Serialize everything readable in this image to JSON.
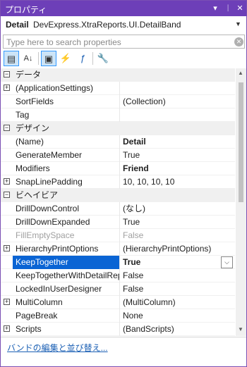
{
  "window": {
    "title": "プロパティ",
    "dropdown_glyph": "▾",
    "pin_glyph": "ᛁ",
    "close_glyph": "✕"
  },
  "object_selector": {
    "name": "Detail",
    "type": "DevExpress.XtraReports.UI.DetailBand",
    "arrow": "▼"
  },
  "search": {
    "placeholder": "Type here to search properties",
    "clear_glyph": "✕"
  },
  "toolbar": {
    "categorized_icon": "▤",
    "alphabetical_icon": "A↓",
    "properties_icon": "▣",
    "events_icon": "⚡",
    "expressions_icon": "ƒ",
    "settings_icon": "🔧"
  },
  "grid": {
    "expand_glyph": "+",
    "collapse_glyph": "−",
    "categories": {
      "data": "データ",
      "design": "デザイン",
      "behavior": "ビヘイビア"
    },
    "rows": {
      "application_settings": {
        "name": "(ApplicationSettings)",
        "value": ""
      },
      "sort_fields": {
        "name": "SortFields",
        "value": "(Collection)"
      },
      "tag": {
        "name": "Tag",
        "value": ""
      },
      "name": {
        "name": "(Name)",
        "value": "Detail"
      },
      "generate_member": {
        "name": "GenerateMember",
        "value": "True"
      },
      "modifiers": {
        "name": "Modifiers",
        "value": "Friend"
      },
      "snap_line_padding": {
        "name": "SnapLinePadding",
        "value": "10, 10, 10, 10"
      },
      "drill_down_control": {
        "name": "DrillDownControl",
        "value": "(なし)"
      },
      "drill_down_expanded": {
        "name": "DrillDownExpanded",
        "value": "True"
      },
      "fill_empty_space": {
        "name": "FillEmptySpace",
        "value": "False"
      },
      "hierarchy_print_options": {
        "name": "HierarchyPrintOptions",
        "value": "(HierarchyPrintOptions)"
      },
      "keep_together": {
        "name": "KeepTogether",
        "value": "True"
      },
      "keep_together_with_detail_rep": {
        "name": "KeepTogetherWithDetailRep",
        "value": "False"
      },
      "locked_in_user_designer": {
        "name": "LockedInUserDesigner",
        "value": "False"
      },
      "multi_column": {
        "name": "MultiColumn",
        "value": "(MultiColumn)"
      },
      "page_break": {
        "name": "PageBreak",
        "value": "None"
      },
      "scripts": {
        "name": "Scripts",
        "value": "(BandScripts)"
      }
    },
    "value_dropdown_glyph": "⌵"
  },
  "scrollbar": {
    "up_glyph": "▲",
    "down_glyph": "▼"
  },
  "footer": {
    "link": "バンドの編集と並び替え..."
  },
  "colors": {
    "titlebar": "#6d3fb8",
    "selection": "#0a64d4",
    "link": "#1a5fb4"
  }
}
